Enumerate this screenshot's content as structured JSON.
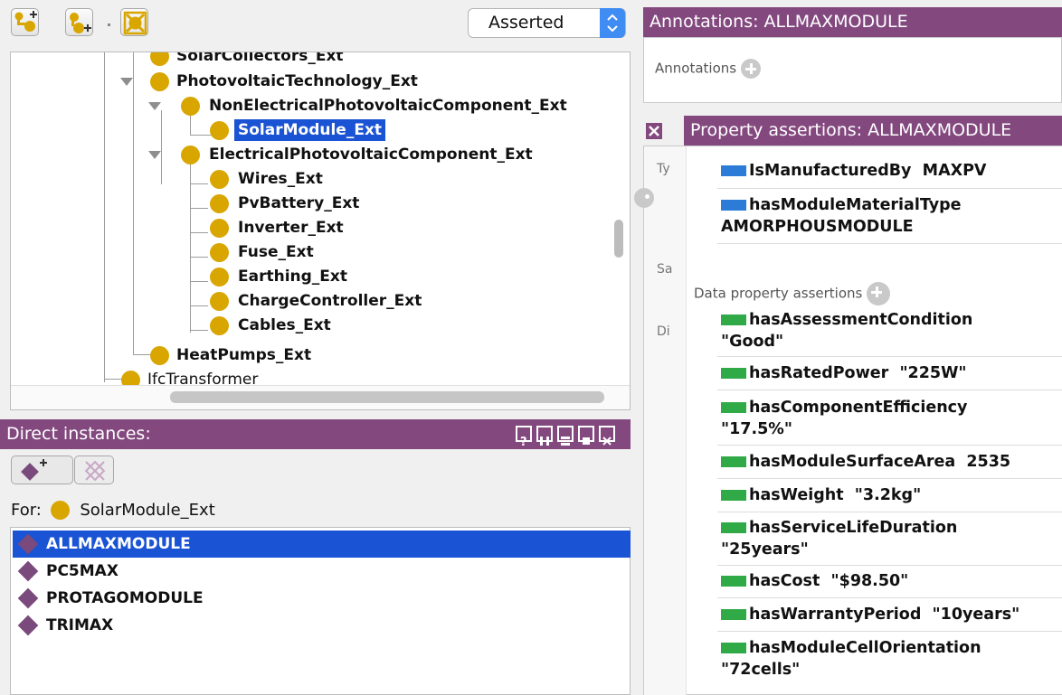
{
  "toolbar": {
    "icons": [
      "add-subclass-icon",
      "add-sibling-class-icon",
      "delete-class-icon"
    ],
    "hierarchy_mode": "Asserted"
  },
  "class_tree": {
    "nodes": [
      {
        "label": "SolarCollectors_Ext"
      },
      {
        "label": "PhotovoltaicTechnology_Ext"
      },
      {
        "label": "NonElectricalPhotovoltaicComponent_Ext"
      },
      {
        "label": "SolarModule_Ext",
        "selected": true
      },
      {
        "label": "ElectricalPhotovoltaicComponent_Ext"
      },
      {
        "label": "Wires_Ext"
      },
      {
        "label": "PvBattery_Ext"
      },
      {
        "label": "Inverter_Ext"
      },
      {
        "label": "Fuse_Ext"
      },
      {
        "label": "Earthing_Ext"
      },
      {
        "label": "ChargeController_Ext"
      },
      {
        "label": "Cables_Ext"
      },
      {
        "label": "HeatPumps_Ext"
      },
      {
        "label": "IfcTransformer"
      }
    ]
  },
  "instances": {
    "title": "Direct instances:",
    "window_controls": [
      "help-icon",
      "split-vertical-icon",
      "split-horizontal-icon",
      "maximize-icon",
      "close-icon"
    ],
    "for_label": "For:",
    "for_class": "SolarModule_Ext",
    "items": [
      "ALLMAXMODULE",
      "PC5MAX",
      "PROTAGOMODULE",
      "TRIMAX"
    ],
    "selected_index": 0
  },
  "annotations": {
    "title": "Annotations: ALLMAXMODULE",
    "label": "Annotations"
  },
  "property_assertions": {
    "title": "Property assertions: ALLMAXMODULE",
    "left_tabs": [
      "Ty",
      "Sa",
      "Di"
    ],
    "object_properties": [
      {
        "name": "IsManufacturedBy",
        "value": "MAXPV"
      },
      {
        "name": "hasModuleMaterialType",
        "value": "AMORPHOUSMODULE"
      }
    ],
    "data_section_label": "Data property assertions",
    "data_properties": [
      {
        "name": "hasAssessmentCondition",
        "value": "\"Good\""
      },
      {
        "name": "hasRatedPower",
        "value": "\"225W\""
      },
      {
        "name": "hasComponentEfficiency",
        "value": "\"17.5%\""
      },
      {
        "name": "hasModuleSurfaceArea",
        "value": "2535"
      },
      {
        "name": "hasWeight",
        "value": "\"3.2kg\""
      },
      {
        "name": "hasServiceLifeDuration",
        "value": "\"25years\""
      },
      {
        "name": "hasCost",
        "value": "\"$98.50\""
      },
      {
        "name": "hasWarrantyPeriod",
        "value": "\"10years\""
      },
      {
        "name": "hasModuleCellOrientation",
        "value": "\"72cells\""
      }
    ]
  },
  "colors": {
    "header_bar": "#83497f",
    "selection": "#1a53d3",
    "class_dot": "#d9a600",
    "individual": "#7a4a7c",
    "data_property": "#2faa46",
    "object_property": "#2c7bd6"
  }
}
